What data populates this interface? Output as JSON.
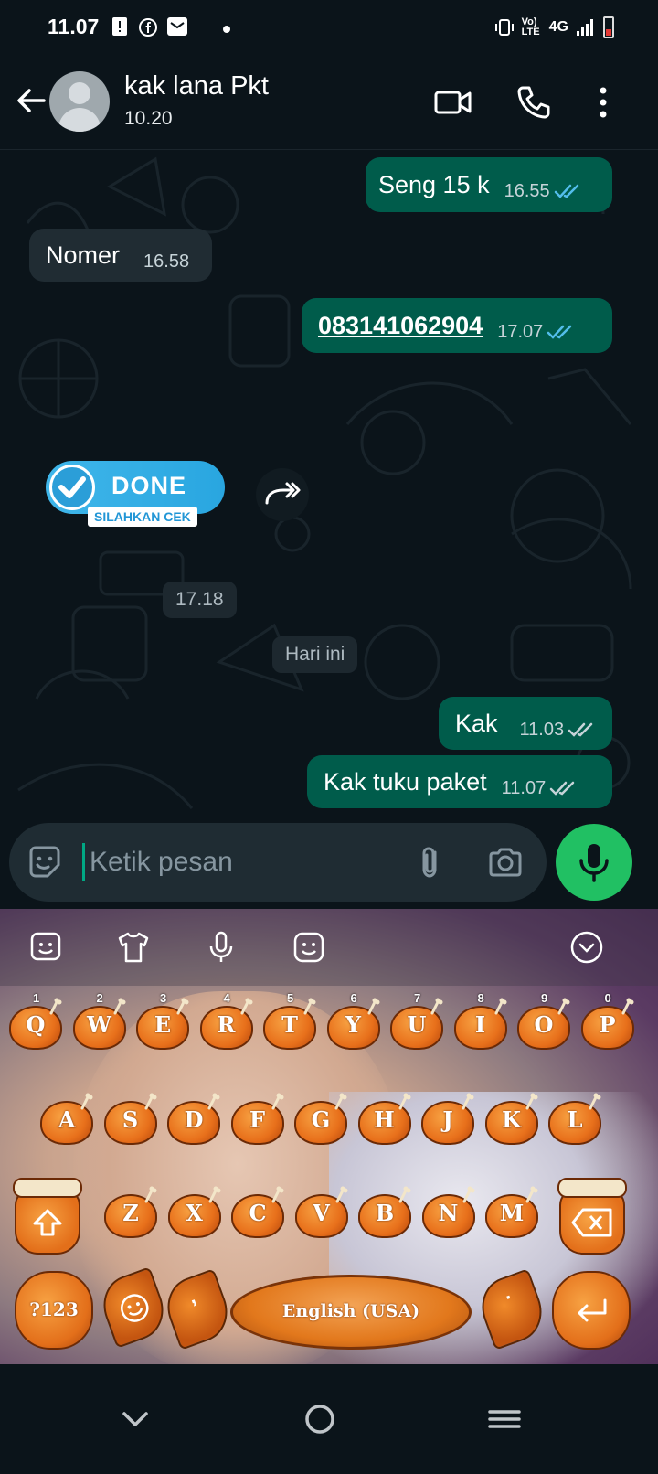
{
  "status_bar": {
    "time": "11.07",
    "network": "4G",
    "volte": "Vo) LTE"
  },
  "header": {
    "contact_name": "kak lana Pkt",
    "contact_status": "10.20"
  },
  "messages": [
    {
      "direction": "out",
      "text": "Seng 15 k",
      "time": "16.55",
      "status": "read"
    },
    {
      "direction": "in",
      "text": "Nomer",
      "time": "16.58"
    },
    {
      "direction": "out",
      "text": "083141062904",
      "time": "17.07",
      "status": "read",
      "is_link": true
    },
    {
      "direction": "in",
      "type": "sticker",
      "sticker_main": "DONE",
      "sticker_sub": "SILAHKAN CEK",
      "time": "17.18"
    },
    {
      "type": "date_divider",
      "text": "Hari ini"
    },
    {
      "direction": "out",
      "text": "Kak",
      "time": "11.03",
      "status": "delivered"
    },
    {
      "direction": "out",
      "text": "Kak tuku paket",
      "time": "11.07",
      "status": "delivered"
    }
  ],
  "composer": {
    "placeholder": "Ketik pesan"
  },
  "keyboard": {
    "row1": [
      {
        "key": "Q",
        "hint": "1"
      },
      {
        "key": "W",
        "hint": "2"
      },
      {
        "key": "E",
        "hint": "3"
      },
      {
        "key": "R",
        "hint": "4"
      },
      {
        "key": "T",
        "hint": "5"
      },
      {
        "key": "Y",
        "hint": "6"
      },
      {
        "key": "U",
        "hint": "7"
      },
      {
        "key": "I",
        "hint": "8"
      },
      {
        "key": "O",
        "hint": "9"
      },
      {
        "key": "P",
        "hint": "0"
      }
    ],
    "row2": [
      "A",
      "S",
      "D",
      "F",
      "G",
      "H",
      "J",
      "K",
      "L"
    ],
    "row3": [
      "Z",
      "X",
      "C",
      "V",
      "B",
      "N",
      "M"
    ],
    "symbols_label": "?123",
    "comma_label": ",",
    "period_label": ".",
    "space_label": "English (USA)"
  },
  "colors": {
    "outgoing_bubble": "#005c4b",
    "incoming_bubble": "#202c33",
    "accent": "#21c063",
    "read_tick": "#53bdeb"
  }
}
